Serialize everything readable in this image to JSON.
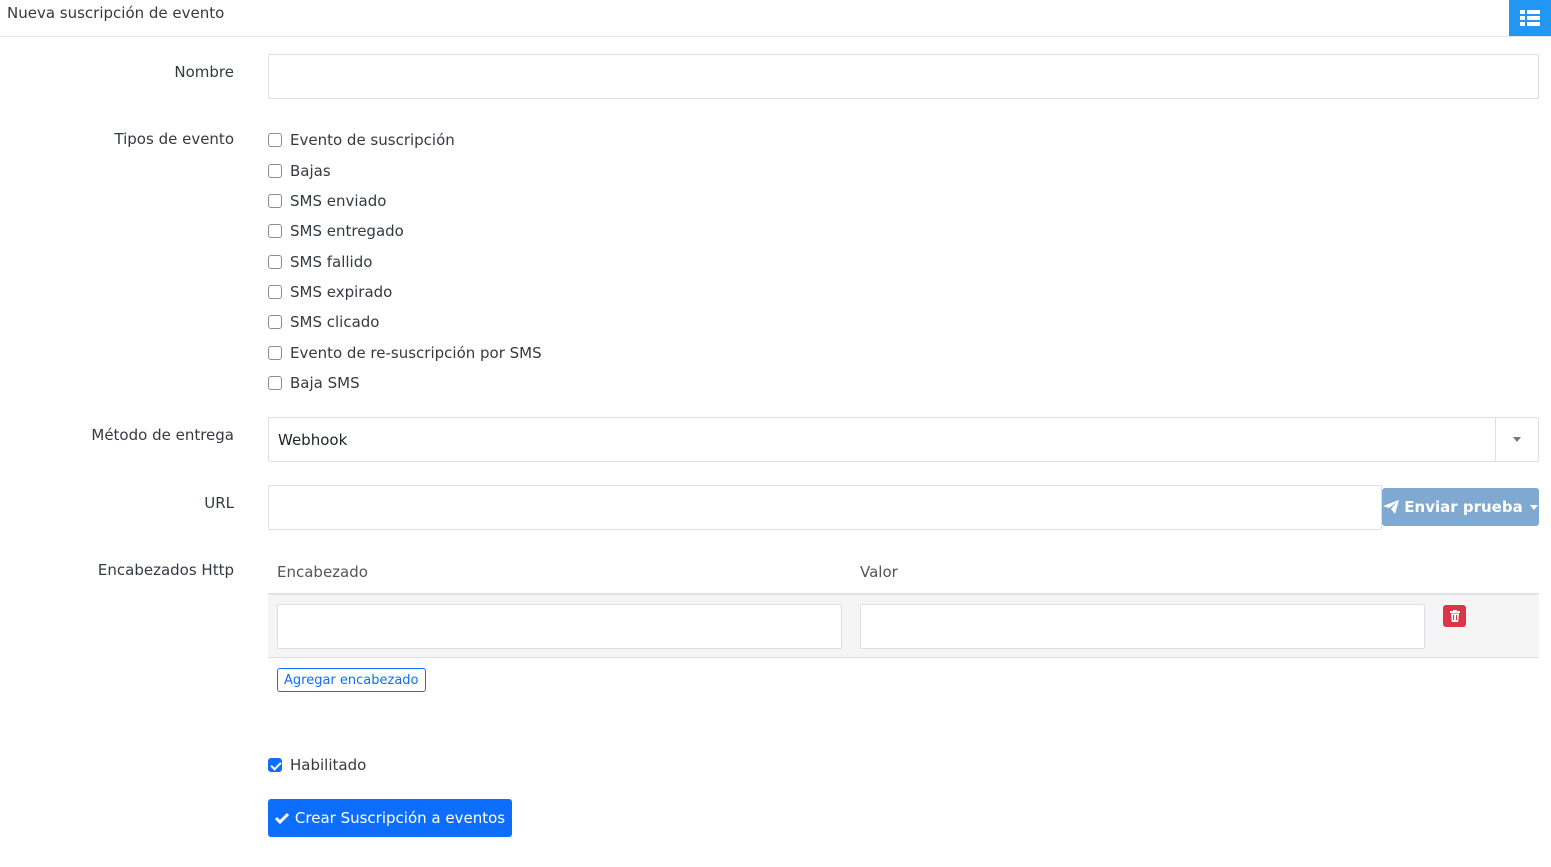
{
  "header": {
    "title": "Nueva suscripción de evento",
    "list_icon": "list-icon"
  },
  "form": {
    "nombre": {
      "label": "Nombre",
      "value": ""
    },
    "tipos": {
      "label": "Tipos de evento",
      "options": [
        {
          "label": "Evento de suscripción",
          "checked": false
        },
        {
          "label": "Bajas",
          "checked": false
        },
        {
          "label": "SMS enviado",
          "checked": false
        },
        {
          "label": "SMS entregado",
          "checked": false
        },
        {
          "label": "SMS fallido",
          "checked": false
        },
        {
          "label": "SMS expirado",
          "checked": false
        },
        {
          "label": "SMS clicado",
          "checked": false
        },
        {
          "label": "Evento de re-suscripción por SMS",
          "checked": false
        },
        {
          "label": "Baja SMS",
          "checked": false
        }
      ]
    },
    "metodo": {
      "label": "Método de entrega",
      "value": "Webhook"
    },
    "url": {
      "label": "URL",
      "value": "",
      "send_test_label": "Enviar prueba"
    },
    "headers": {
      "label": "Encabezados Http",
      "col_header": "Encabezado",
      "col_value": "Valor",
      "add_label": "Agregar encabezado"
    },
    "habilitado": {
      "label": "Habilitado",
      "checked": true
    },
    "submit_label": "Crear Suscripción a eventos"
  },
  "colors": {
    "primary": "#0d6efd",
    "danger": "#dc3545",
    "info": "#2196f3",
    "send_test": "#7fa9d1"
  }
}
